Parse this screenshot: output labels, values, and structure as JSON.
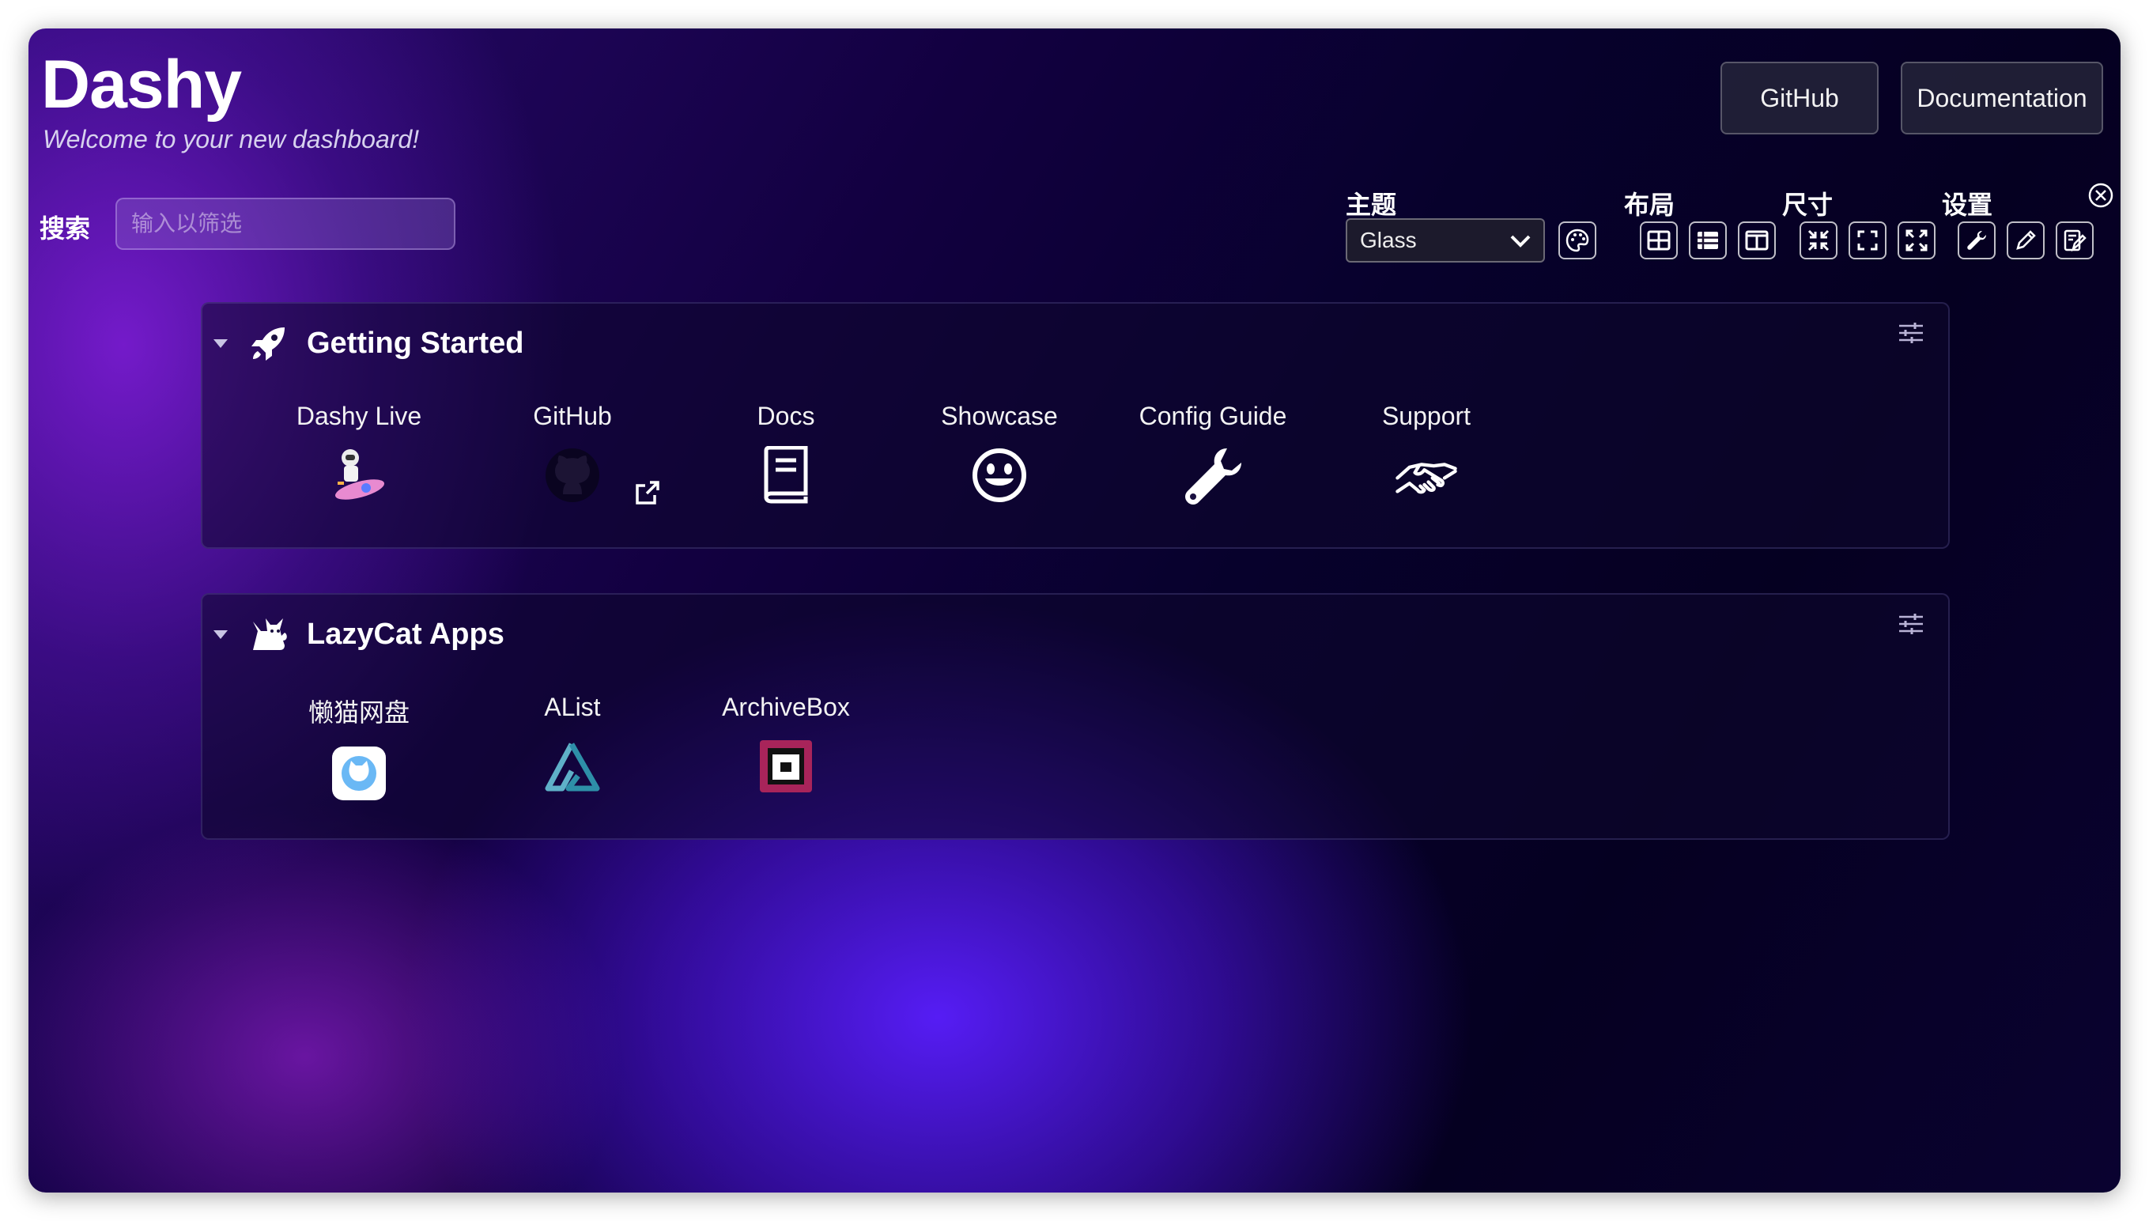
{
  "header": {
    "title": "Dashy",
    "subtitle": "Welcome to your new dashboard!"
  },
  "nav": {
    "github_label": "GitHub",
    "docs_label": "Documentation"
  },
  "search": {
    "label": "搜索",
    "placeholder": "输入以筛选"
  },
  "controls": {
    "theme_label": "主题",
    "theme_value": "Glass",
    "layout_label": "布局",
    "size_label": "尺寸",
    "settings_label": "设置"
  },
  "sections": [
    {
      "title": "Getting Started",
      "icon": "rocket-icon",
      "items": [
        {
          "label": "Dashy Live",
          "icon": "astronaut-rocket-icon"
        },
        {
          "label": "GitHub",
          "icon": "github-icon"
        },
        {
          "label": "Docs",
          "icon": "book-icon"
        },
        {
          "label": "Showcase",
          "icon": "smile-icon"
        },
        {
          "label": "Config Guide",
          "icon": "wrench-icon"
        },
        {
          "label": "Support",
          "icon": "handshake-icon"
        }
      ]
    },
    {
      "title": "LazyCat Apps",
      "icon": "cat-icon",
      "items": [
        {
          "label": "懒猫网盘",
          "icon": "lazycat-drive-icon"
        },
        {
          "label": "AList",
          "icon": "alist-icon"
        },
        {
          "label": "ArchiveBox",
          "icon": "archivebox-icon"
        }
      ]
    }
  ],
  "colors": {
    "accent": "#5a1eff",
    "background": "#07012c",
    "text": "#ffffff"
  }
}
